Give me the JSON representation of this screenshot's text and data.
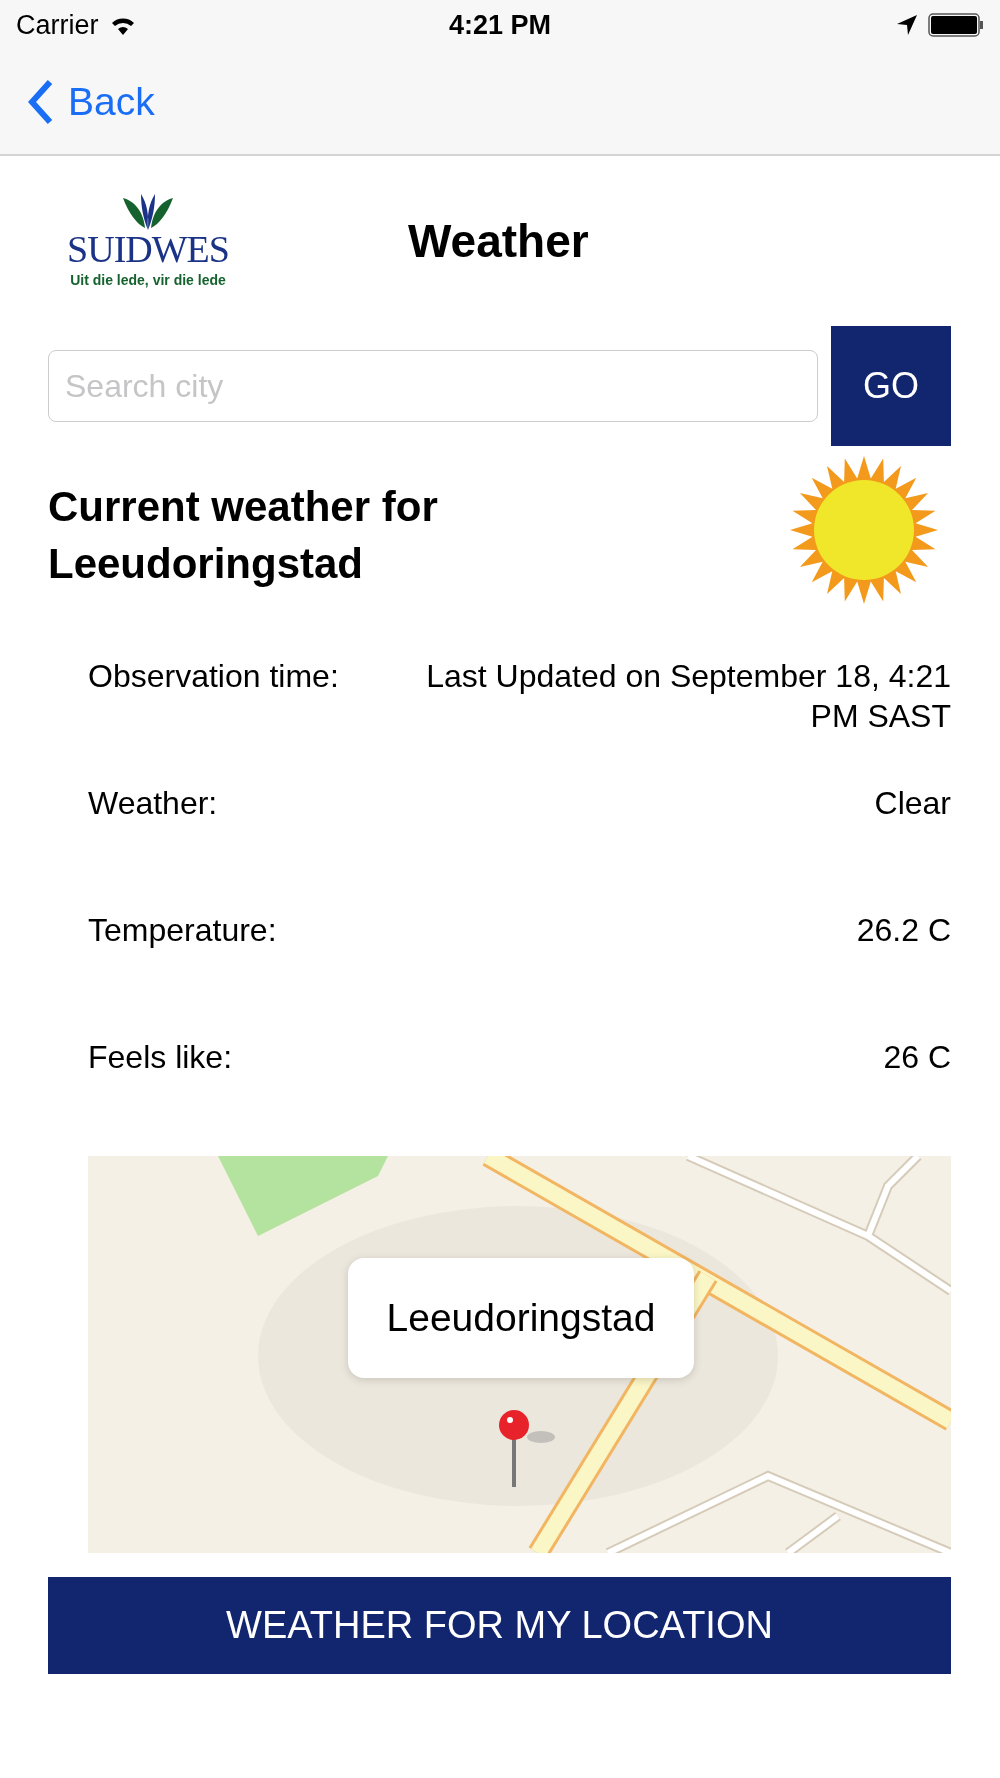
{
  "status_bar": {
    "carrier": "Carrier",
    "time": "4:21 PM"
  },
  "nav": {
    "back": "Back"
  },
  "logo": {
    "name": "SUIDWES",
    "tagline": "Uit die lede, vir die lede"
  },
  "title": "Weather",
  "search": {
    "placeholder": "Search city",
    "button": "GO"
  },
  "heading": "Current weather for Leeudoringstad",
  "rows": [
    {
      "label": "Observation time:",
      "value": "Last Updated on September 18, 4:21 PM SAST"
    },
    {
      "label": "Weather:",
      "value": "Clear"
    },
    {
      "label": "Temperature:",
      "value": "26.2 C"
    },
    {
      "label": "Feels like:",
      "value": "26 C"
    }
  ],
  "map": {
    "kind": "picture",
    "callout": "Leeudoringstad"
  },
  "location_button": "WEATHER FOR MY LOCATION"
}
